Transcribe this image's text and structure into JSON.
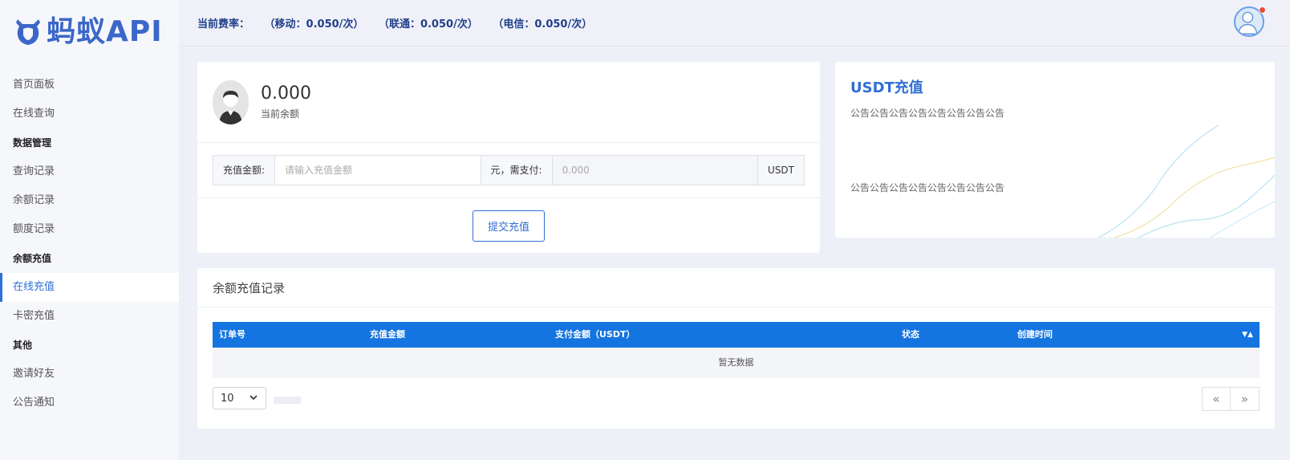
{
  "brand": {
    "name": "蚂蚁API",
    "color": "#3b67c8"
  },
  "header": {
    "rates": [
      "当前费率：",
      "（移动：0.050/次）",
      "（联通：0.050/次）",
      "（电信：0.050/次）"
    ]
  },
  "sidebar": {
    "items": [
      {
        "type": "item",
        "label": "首页面板"
      },
      {
        "type": "item",
        "label": "在线查询"
      },
      {
        "type": "head",
        "label": "数据管理"
      },
      {
        "type": "item",
        "label": "查询记录"
      },
      {
        "type": "item",
        "label": "余额记录"
      },
      {
        "type": "item",
        "label": "额度记录"
      },
      {
        "type": "head",
        "label": "余额充值"
      },
      {
        "type": "item",
        "label": "在线充值",
        "active": true
      },
      {
        "type": "item",
        "label": "卡密充值"
      },
      {
        "type": "head",
        "label": "其他"
      },
      {
        "type": "item",
        "label": "邀请好友"
      },
      {
        "type": "item",
        "label": "公告通知"
      }
    ]
  },
  "balance": {
    "value": "0.000",
    "label": "当前余额"
  },
  "recharge": {
    "amount_label": "充值金额:",
    "amount_placeholder": "请输入充值金额",
    "mid_label": "元，需支付:",
    "pay_value": "0.000",
    "unit": "USDT",
    "submit_label": "提交充值"
  },
  "usdt": {
    "title": "USDT充值",
    "notice1": "公告公告公告公告公告公告公告公告",
    "notice2": "公告公告公告公告公告公告公告公告"
  },
  "records": {
    "title": "余额充值记录",
    "columns": [
      "订单号",
      "充值金额",
      "支付金额（USDT）",
      "状态",
      "创建时间"
    ],
    "empty_text": "暂无数据",
    "page_size": "10",
    "prev": "«",
    "next": "»"
  },
  "colors": {
    "accent": "#2f6fd6",
    "table_header": "#1474e0",
    "notify": "#ea4b3c"
  }
}
